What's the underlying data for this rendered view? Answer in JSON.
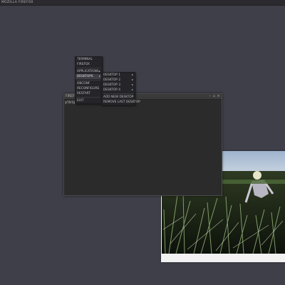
{
  "topbar": {
    "title": "MOZILLA FIREFOX"
  },
  "root_menu": {
    "items": [
      {
        "label": "TERMINAL",
        "submenu": false
      },
      {
        "label": "FIREFOX",
        "submenu": false
      },
      {
        "label": "APPLICATIONS",
        "submenu": true
      },
      {
        "label": "DESKTOPS",
        "submenu": true,
        "active": true
      },
      {
        "label": "OBCONF",
        "submenu": false
      },
      {
        "label": "RECONFIGURE",
        "submenu": false
      },
      {
        "label": "RESTART",
        "submenu": false
      },
      {
        "label": "EXIT",
        "submenu": false
      }
    ]
  },
  "desktops_menu": {
    "items": [
      {
        "label": "DESKTOP 1",
        "submenu": true
      },
      {
        "label": "DESKTOP 2",
        "submenu": true
      },
      {
        "label": "DESKTOP 3",
        "submenu": true
      },
      {
        "label": "DESKTOP 4",
        "submenu": true
      },
      {
        "label": "ADD NEW DESKTOP",
        "submenu": false
      },
      {
        "label": "REMOVE LAST DESKTOP",
        "submenu": false
      }
    ]
  },
  "terminal": {
    "title": "FIREFOX",
    "prompt": "ylbl@europa:~$",
    "buttons": {
      "minimize": "–",
      "maximize": "▫",
      "close": "×"
    }
  },
  "photo": {
    "description_icon": "photo-icon"
  }
}
